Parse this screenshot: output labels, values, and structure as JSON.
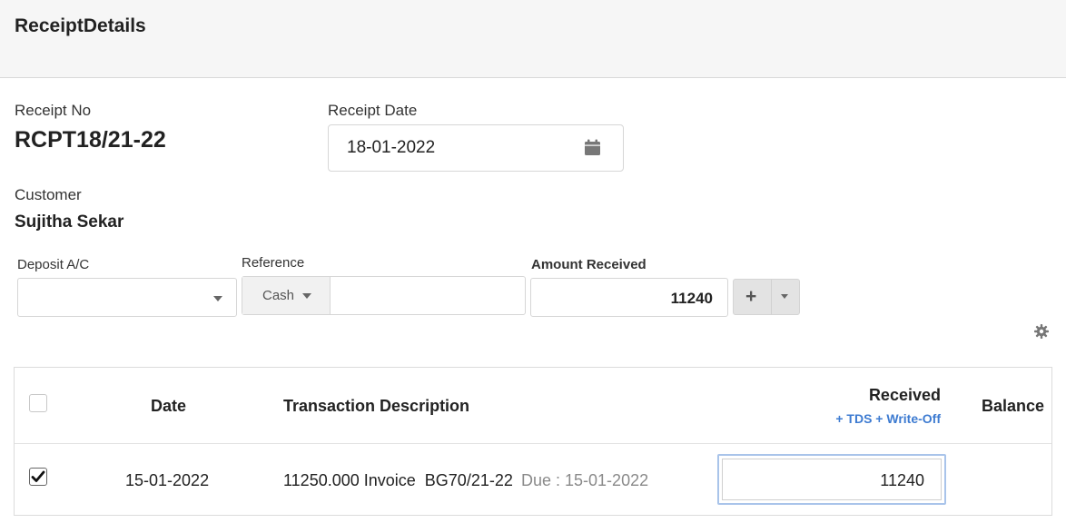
{
  "header": {
    "title": "ReceiptDetails"
  },
  "receipt": {
    "no_label": "Receipt No",
    "no_value": "RCPT18/21-22",
    "date_label": "Receipt Date",
    "date_value": "18-01-2022"
  },
  "customer": {
    "label": "Customer",
    "name": "Sujitha Sekar"
  },
  "deposit": {
    "label": "Deposit A/C",
    "value": ""
  },
  "reference": {
    "label": "Reference",
    "mode": "Cash",
    "value": ""
  },
  "amount": {
    "label": "Amount Received",
    "value": "11240",
    "add_label": "+"
  },
  "table": {
    "headers": {
      "date": "Date",
      "description": "Transaction Description",
      "received": "Received",
      "received_sub": "+ TDS + Write-Off",
      "balance": "Balance"
    },
    "rows": [
      {
        "checked": true,
        "date": "15-01-2022",
        "description": "11250.000 Invoice  BG70/21-22",
        "due": "Due : 15-01-2022",
        "received": "11240",
        "balance": ""
      }
    ]
  },
  "icons": [
    "calendar-icon",
    "caret-down-icon",
    "plus-icon",
    "gear-icon",
    "checkbox-icon"
  ]
}
